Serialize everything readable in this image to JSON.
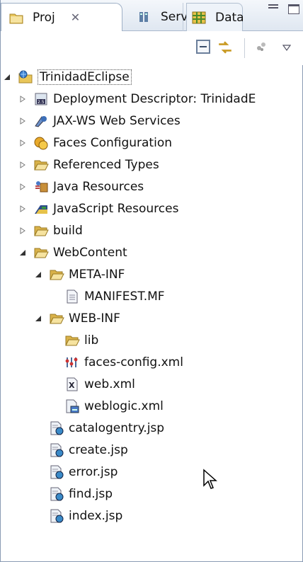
{
  "tabs": [
    {
      "label": "Proj",
      "icon": "project-explorer-icon",
      "active": true
    },
    {
      "label": "Serv",
      "icon": "servers-icon",
      "active": false
    },
    {
      "label": "Data",
      "icon": "data-source-icon",
      "active": false
    }
  ],
  "toolbar": {
    "collapse": "collapse-all-icon",
    "link": "link-with-editor-icon",
    "filter": "filter-icon",
    "menu": "view-menu-icon"
  },
  "tree": {
    "root": "TrinidadEclipse",
    "items": {
      "deployment": "Deployment Descriptor: TrinidadE",
      "jaxws": "JAX-WS Web Services",
      "faces": "Faces Configuration",
      "reftypes": "Referenced Types",
      "javares": "Java Resources",
      "jsres": "JavaScript Resources",
      "build": "build",
      "webcontent": "WebContent",
      "metainf": "META-INF",
      "manifest": "MANIFEST.MF",
      "webinf": "WEB-INF",
      "lib": "lib",
      "facesconfig": "faces-config.xml",
      "webxml": "web.xml",
      "weblogic": "weblogic.xml",
      "catalog": "catalogentry.jsp",
      "create": "create.jsp",
      "error": "error.jsp",
      "find": "find.jsp",
      "index": "index.jsp"
    }
  },
  "colors": {
    "folder": "#e9c65a",
    "selection_border": "#555555",
    "tab_border": "#9fb0c6"
  }
}
